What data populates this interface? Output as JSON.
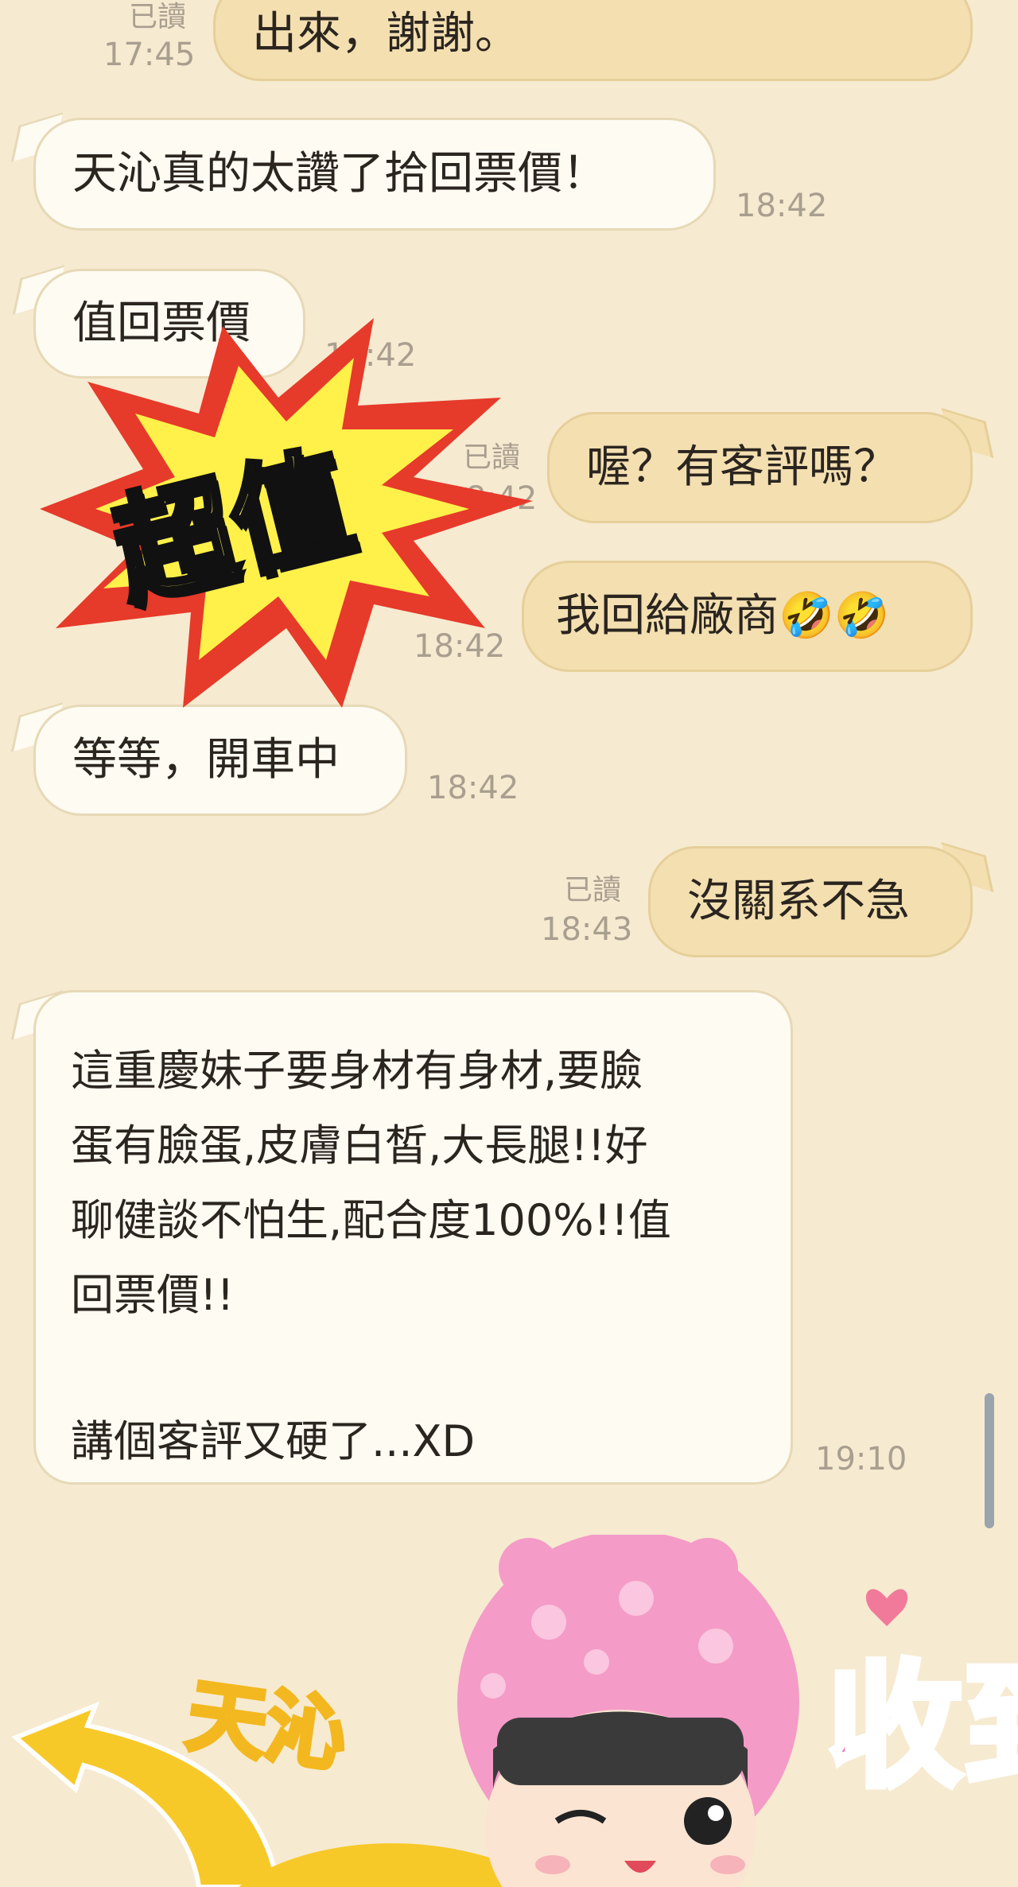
{
  "messages": [
    {
      "side": "out",
      "text": "出來，謝謝。",
      "read": "已讀",
      "time": "17:45"
    },
    {
      "side": "in",
      "text": "天沁真的太讚了拾回票價！",
      "time": "18:42"
    },
    {
      "side": "in",
      "text": "值回票價",
      "time": "18:42"
    },
    {
      "side": "out",
      "text": "喔？有客評嗎？",
      "read": "已讀",
      "time": "18:42"
    },
    {
      "side": "out",
      "text": "我回給廠商🤣🤣",
      "time": "18:42"
    },
    {
      "side": "in",
      "text": "等等，開車中",
      "time": "18:42"
    },
    {
      "side": "out",
      "text": "沒關系不急",
      "read": "已讀",
      "time": "18:43"
    }
  ],
  "long_message": {
    "lines": [
      "這重慶妹子要身材有身材,要臉",
      "蛋有臉蛋,皮膚白皙,大長腿!!好",
      "聊健談不怕生,配合度100%!!值",
      "回票價!!",
      "講個客評又硬了...XD"
    ],
    "time": "19:10"
  },
  "stickers": {
    "burst_text": "超值",
    "bottom_left_text": "天沁",
    "bottom_right_text": "收到"
  },
  "colors": {
    "background": "#f6ead0",
    "incoming_bubble": "#fdfbf2",
    "outgoing_bubble": "#f3dfb0",
    "burst_red": "#e63a2a",
    "burst_yellow": "#fff04a",
    "sticker_pink": "#f06fb4"
  }
}
